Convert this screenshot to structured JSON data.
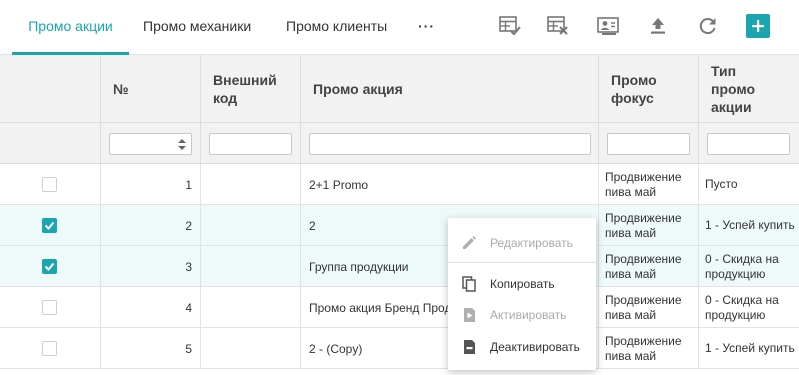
{
  "tabs": [
    {
      "label": "Промо акции",
      "active": true
    },
    {
      "label": "Промо механики",
      "active": false
    },
    {
      "label": "Промо клиенты",
      "active": false
    }
  ],
  "more_label": "···",
  "toolbar_icons": [
    "table-check-icon",
    "table-delete-icon",
    "assign-user-icon",
    "upload-icon",
    "refresh-icon",
    "add-icon"
  ],
  "columns": {
    "num": "№",
    "external_code": "Внешний код",
    "promo": "Промо акция",
    "focus": "Промо фокус",
    "type": "Тип промо акции"
  },
  "rows": [
    {
      "selected": false,
      "num": "1",
      "external_code": "",
      "promo": "2+1 Promo",
      "focus": "Продвижение пива май",
      "type": "Пусто"
    },
    {
      "selected": true,
      "num": "2",
      "external_code": "",
      "promo": "2",
      "focus": "Продвижение пива май",
      "type": "1 - Успей купить"
    },
    {
      "selected": true,
      "num": "3",
      "external_code": "",
      "promo": "Группа продукции",
      "focus": "Продвижение пива май",
      "type": "0 - Скидка на продукцию"
    },
    {
      "selected": false,
      "num": "4",
      "external_code": "",
      "promo": "Промо акция Бренд Прод",
      "focus": "Продвижение пива май",
      "type": "0 - Скидка на продукцию"
    },
    {
      "selected": false,
      "num": "5",
      "external_code": "",
      "promo": "2 - (Copy)",
      "focus": "Продвижение пива май",
      "type": "1 - Успей купить"
    }
  ],
  "context_menu": {
    "edit": "Редактировать",
    "copy": "Копировать",
    "activate": "Активировать",
    "deactivate": "Деактивировать"
  },
  "colors": {
    "accent": "#1aa5b0",
    "selected_row": "#eefafa",
    "header_bg": "#f2f2f2"
  }
}
